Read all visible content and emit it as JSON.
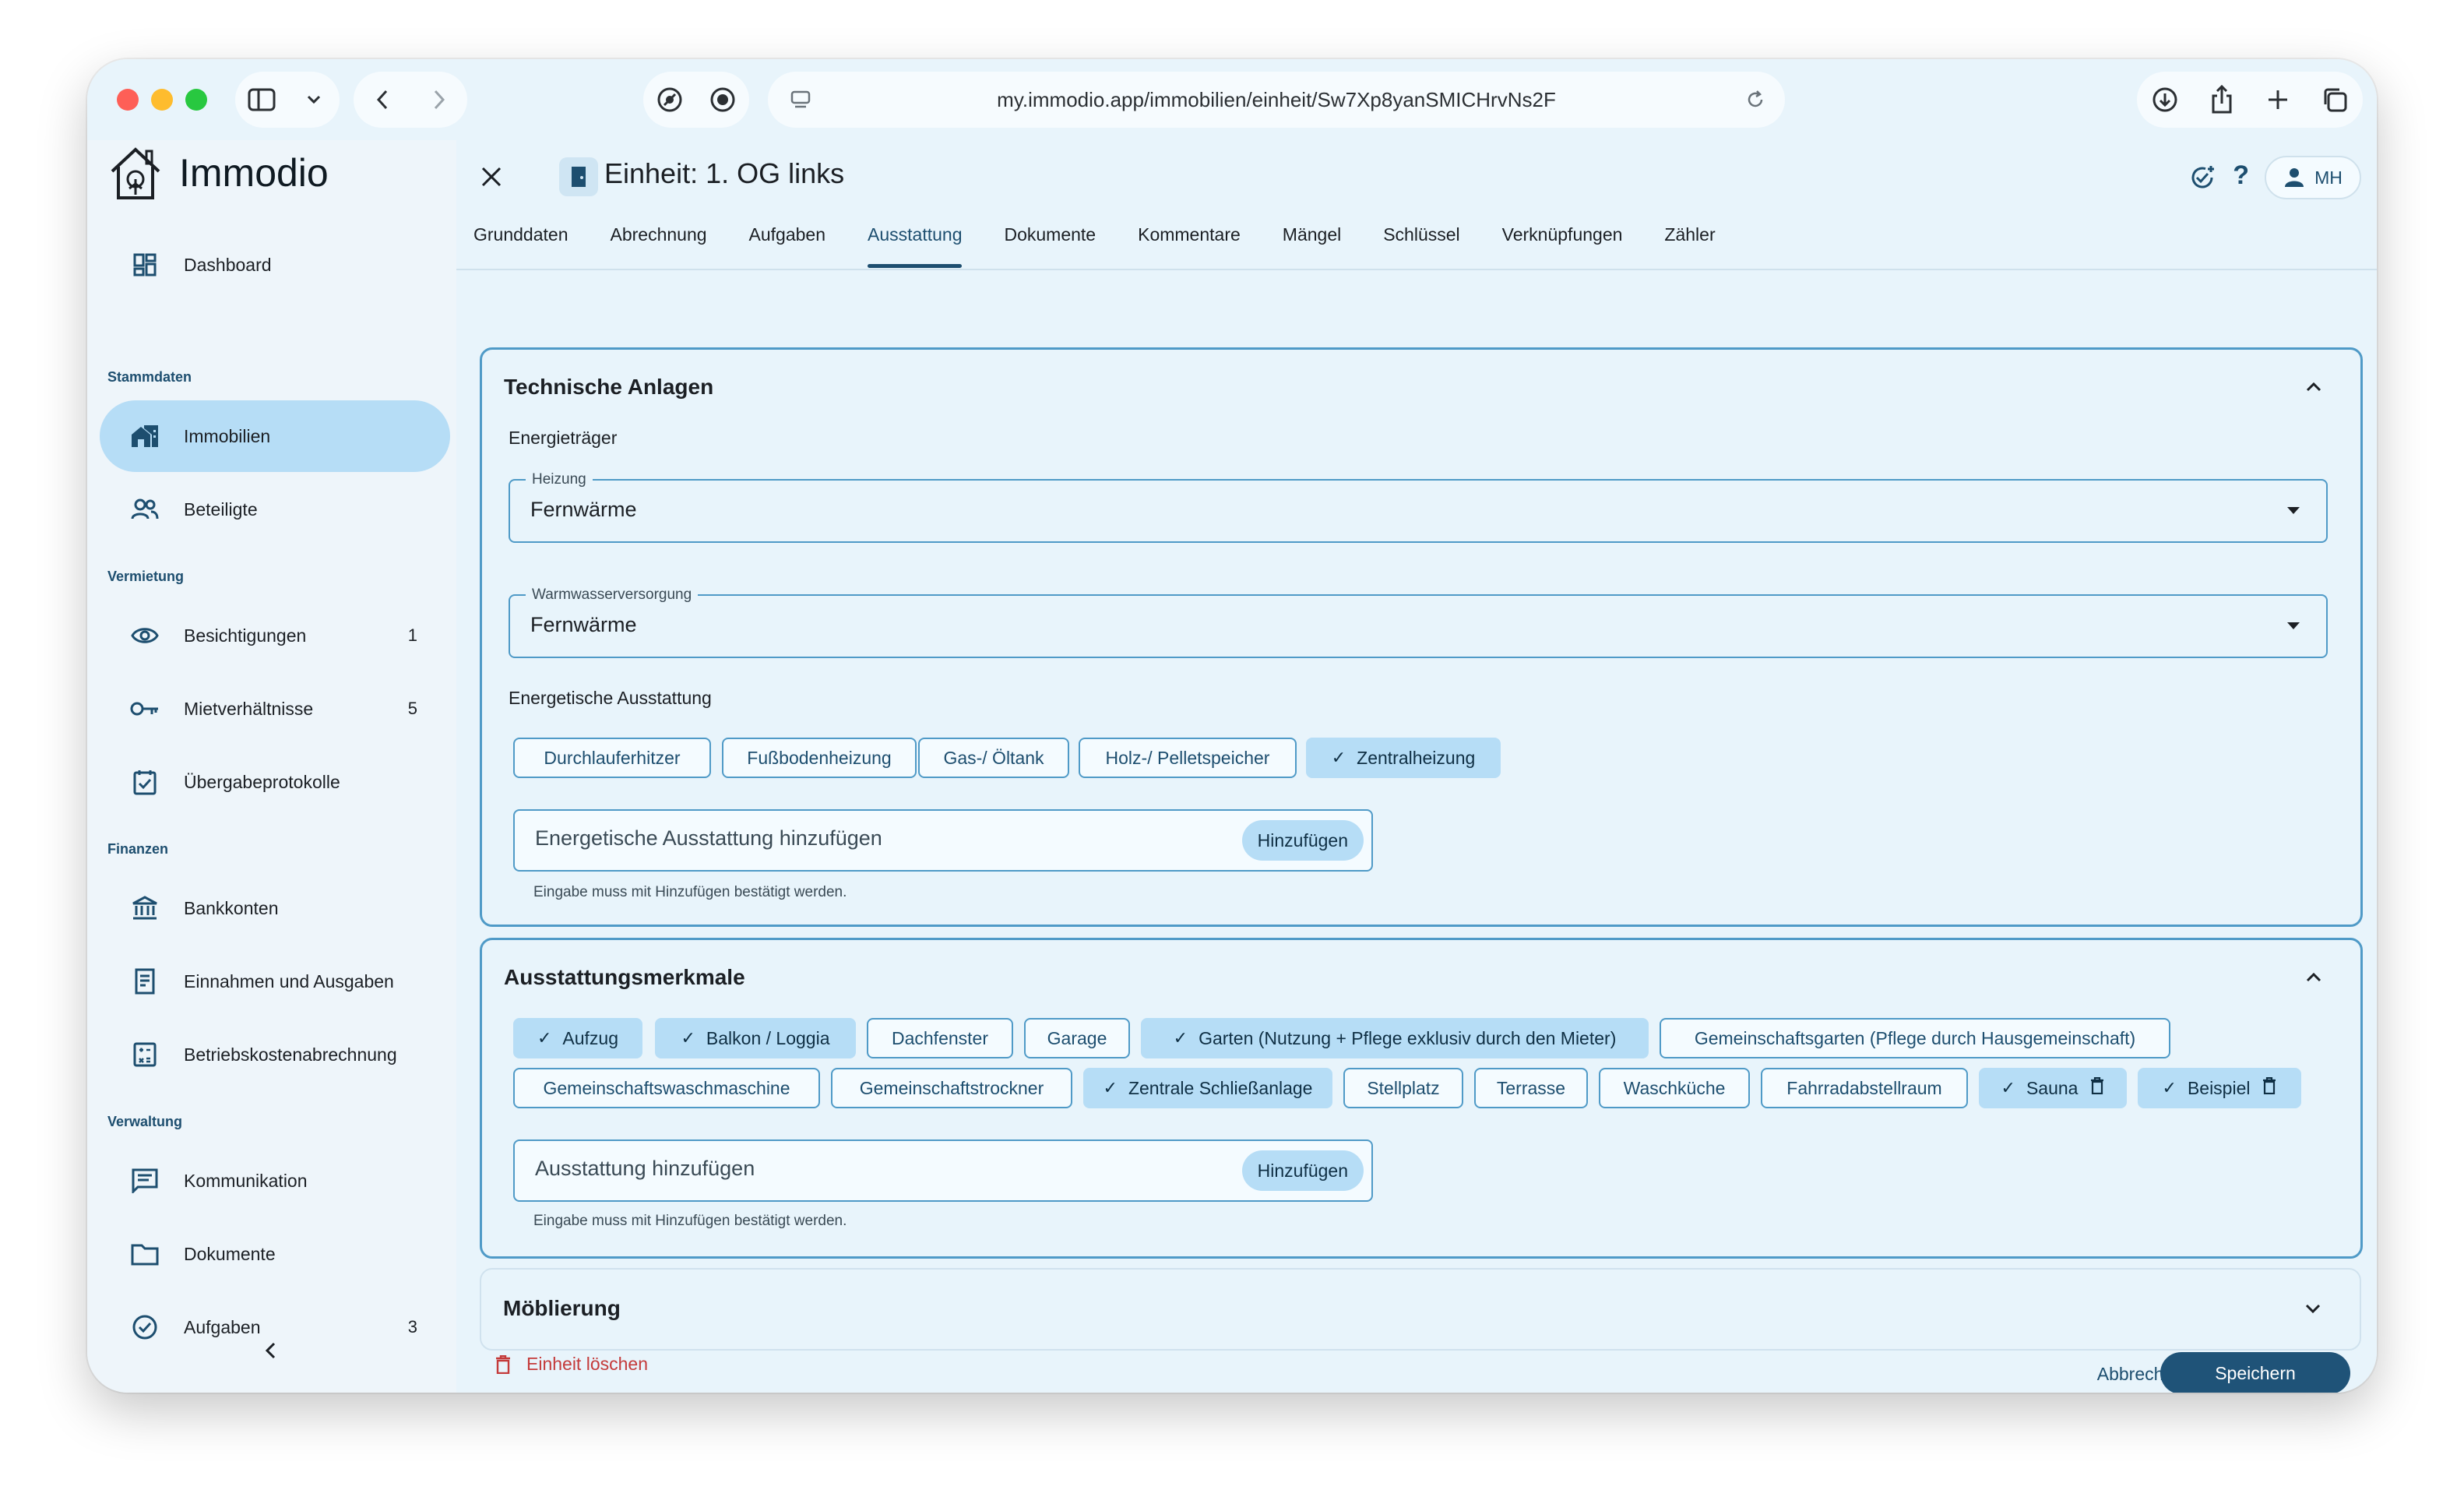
{
  "browser": {
    "url": "my.immodio.app/immobilien/einheit/Sw7Xp8yanSMICHrvNs2F"
  },
  "app": {
    "name": "Immodio"
  },
  "sidebar": {
    "items": [
      {
        "label": "Dashboard"
      },
      {
        "label": "Immobilien"
      },
      {
        "label": "Beteiligte"
      },
      {
        "label": "Besichtigungen",
        "count": "1"
      },
      {
        "label": "Mietverhältnisse",
        "count": "5"
      },
      {
        "label": "Übergabeprotokolle"
      },
      {
        "label": "Bankkonten"
      },
      {
        "label": "Einnahmen und Ausgaben"
      },
      {
        "label": "Betriebskostenabrechnung"
      },
      {
        "label": "Kommunikation"
      },
      {
        "label": "Dokumente"
      },
      {
        "label": "Aufgaben",
        "count": "3"
      }
    ],
    "sections": {
      "stammdaten": "Stammdaten",
      "vermietung": "Vermietung",
      "finanzen": "Finanzen",
      "verwaltung": "Verwaltung"
    }
  },
  "header": {
    "title": "Einheit: 1. OG links",
    "user_initials": "MH"
  },
  "tabs": [
    "Grunddaten",
    "Abrechnung",
    "Aufgaben",
    "Ausstattung",
    "Dokumente",
    "Kommentare",
    "Mängel",
    "Schlüssel",
    "Verknüpfungen",
    "Zähler"
  ],
  "technische_anlagen": {
    "title": "Technische Anlagen",
    "energietraeger_label": "Energieträger",
    "heizung": {
      "label": "Heizung",
      "value": "Fernwärme"
    },
    "warmwasser": {
      "label": "Warmwasserversorgung",
      "value": "Fernwärme"
    },
    "ausstattung_label": "Energetische Ausstattung",
    "chips": [
      {
        "label": "Durchlauferhitzer",
        "selected": false
      },
      {
        "label": "Fußbodenheizung",
        "selected": false
      },
      {
        "label": "Gas-/ Öltank",
        "selected": false
      },
      {
        "label": "Holz-/ Pelletspeicher",
        "selected": false
      },
      {
        "label": "Zentralheizung",
        "selected": true
      }
    ],
    "add_placeholder": "Energetische Ausstattung hinzufügen",
    "add_button": "Hinzufügen",
    "hint": "Eingabe muss mit Hinzufügen bestätigt werden."
  },
  "ausstattungsmerkmale": {
    "title": "Ausstattungsmerkmale",
    "chips": [
      {
        "label": "Aufzug",
        "selected": true
      },
      {
        "label": "Balkon / Loggia",
        "selected": true
      },
      {
        "label": "Dachfenster",
        "selected": false
      },
      {
        "label": "Garage",
        "selected": false
      },
      {
        "label": "Garten (Nutzung + Pflege exklusiv durch den Mieter)",
        "selected": true
      },
      {
        "label": "Gemeinschaftsgarten (Pflege durch Hausgemeinschaft)",
        "selected": false
      },
      {
        "label": "Gemeinschaftswaschmaschine",
        "selected": false
      },
      {
        "label": "Gemeinschaftstrockner",
        "selected": false
      },
      {
        "label": "Zentrale Schließanlage",
        "selected": true
      },
      {
        "label": "Stellplatz",
        "selected": false
      },
      {
        "label": "Terrasse",
        "selected": false
      },
      {
        "label": "Waschküche",
        "selected": false
      },
      {
        "label": "Fahrradabstellraum",
        "selected": false
      },
      {
        "label": "Sauna",
        "selected": true
      },
      {
        "label": "Beispiel",
        "selected": true
      }
    ],
    "add_placeholder": "Ausstattung hinzufügen",
    "add_button": "Hinzufügen",
    "hint": "Eingabe muss mit Hinzufügen bestätigt werden."
  },
  "moeblierung": {
    "title": "Möblierung"
  },
  "footer": {
    "delete_label": "Einheit löschen",
    "cancel_label": "Abbrechen",
    "save_label": "Speichern"
  },
  "colors": {
    "accent": "#1d4e6f",
    "selected_bg": "#b6ddf6",
    "danger": "#c43a3a",
    "save_bg": "#1f5378"
  }
}
